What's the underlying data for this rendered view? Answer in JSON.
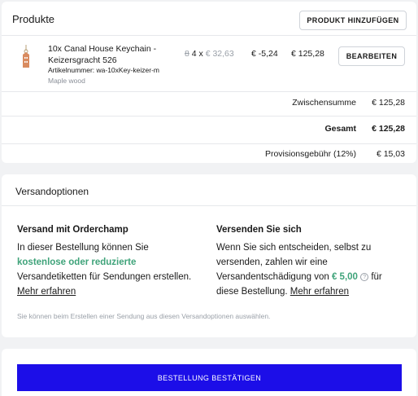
{
  "products": {
    "title": "Produkte",
    "add_button": "PRODUKT HINZUFÜGEN",
    "item": {
      "name": "10x Canal House Keychain - Keizersgracht 526",
      "sku_label": "Artikelnummer: wa-10xKey-keizer-m",
      "variant": "Maple wood",
      "old_qty": "8",
      "qty": "4 x",
      "unit_price": "€ 32,63",
      "discount": "€ -5,24",
      "total": "€ 125,28",
      "edit_button": "BEARBEITEN"
    },
    "summary": {
      "subtotal_label": "Zwischensumme",
      "subtotal_value": "€ 125,28",
      "total_label": "Gesamt",
      "total_value": "€ 125,28",
      "fee_label": "Provisionsgebühr (12%)",
      "fee_value": "€ 15,03"
    }
  },
  "shipping": {
    "title": "Versandoptionen",
    "orderchamp": {
      "heading": "Versand mit Orderchamp",
      "text_1": "In dieser Bestellung können Sie",
      "highlight": "kostenlose oder reduzierte",
      "text_2": "Versandetiketten für Sendungen erstellen.",
      "link": "Mehr erfahren"
    },
    "self": {
      "heading": "Versenden Sie sich",
      "text_1": "Wenn Sie sich entscheiden, selbst zu versenden, zahlen wir eine Versandentschädigung von",
      "amount": "€ 5,00",
      "help_icon": "question-circle-icon",
      "text_2": "für diese Bestellung.",
      "link": "Mehr erfahren"
    },
    "footnote": "Sie können beim Erstellen einer Sendung aus diesen Versandoptionen auswählen."
  },
  "confirm": {
    "button": "BESTELLUNG BESTÄTIGEN"
  },
  "colors": {
    "accent": "#1c0ee8",
    "green": "#3fa37a",
    "background": "#f1f2f4"
  }
}
